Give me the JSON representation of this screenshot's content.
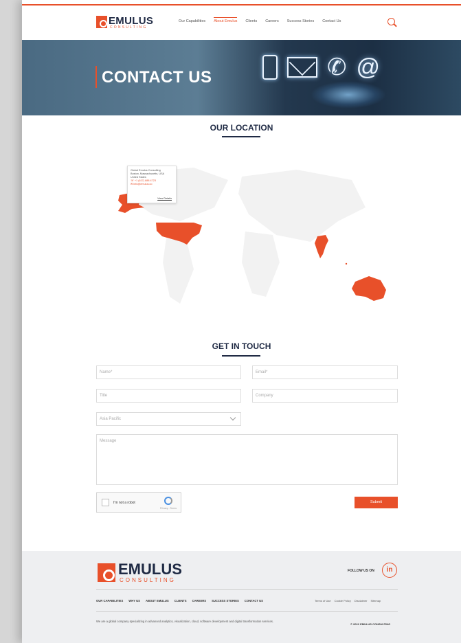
{
  "header": {
    "logo_word": "EMULUS",
    "logo_sub": "CONSULTING",
    "nav": [
      {
        "label": "Our Capabilities",
        "active": false
      },
      {
        "label": "About Emulus",
        "active": true
      },
      {
        "label": "Clients",
        "active": false
      },
      {
        "label": "Careers",
        "active": false
      },
      {
        "label": "Success Stories",
        "active": false
      },
      {
        "label": "Contact Us",
        "active": false
      }
    ]
  },
  "hero": {
    "title": "CONTACT US",
    "icons": [
      "phone-icon",
      "mail-icon",
      "telephone-icon",
      "at-icon"
    ]
  },
  "location": {
    "title": "OUR LOCATION",
    "popup": {
      "line1": "Global Emulus Consulting",
      "line2": "Boston, Massachusetts, USA",
      "line3": "United States",
      "phone": "+1 (617) 888 4723",
      "email": "info@emulus.co",
      "link": "View Details"
    }
  },
  "contact": {
    "title": "GET IN TOUCH",
    "name_placeholder": "Name*",
    "email_placeholder": "Email*",
    "title_placeholder": "Title",
    "company_placeholder": "Company",
    "region_value": "Asia Pacific",
    "message_placeholder": "Message",
    "captcha_label": "I'm not a robot",
    "captcha_fine": "Privacy - Terms",
    "submit_label": "Submit"
  },
  "footer": {
    "logo_word": "EMULUS",
    "logo_sub": "CONSULTING",
    "follow_label": "FOLLOW US ON",
    "linkedin": "in",
    "links": [
      "OUR CAPABILITIES",
      "WHY US",
      "ABOUT EMULUS",
      "CLIENTS",
      "CAREERS",
      "SUCCESS STORIES",
      "CONTACT US"
    ],
    "legal_links": [
      "Terms of Use",
      "Cookie Policy",
      "Disclaimer",
      "Sitemap"
    ],
    "description": "We are a global company specializing in advanced analytics, visualization, cloud, software development and digital transformation services.",
    "copyright": "© 2022 EMULUS CONSULTING"
  },
  "colors": {
    "accent": "#e8502a",
    "navy": "#1f2a44"
  }
}
